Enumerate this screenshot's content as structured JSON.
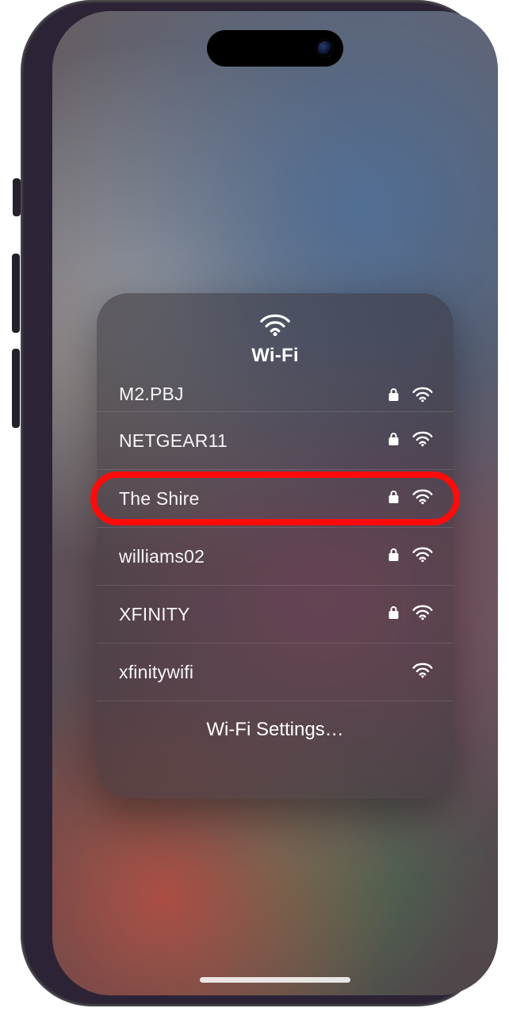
{
  "panel": {
    "title": "Wi-Fi",
    "settings_label": "Wi-Fi Settings…",
    "networks": [
      {
        "ssid": "M2.PBJ",
        "locked": true,
        "highlighted": false,
        "cut": true
      },
      {
        "ssid": "NETGEAR11",
        "locked": true,
        "highlighted": false,
        "cut": false
      },
      {
        "ssid": "The Shire",
        "locked": true,
        "highlighted": true,
        "cut": false
      },
      {
        "ssid": "williams02",
        "locked": true,
        "highlighted": false,
        "cut": false
      },
      {
        "ssid": "XFINITY",
        "locked": true,
        "highlighted": false,
        "cut": false
      },
      {
        "ssid": "xfinitywifi",
        "locked": false,
        "highlighted": false,
        "cut": false
      }
    ]
  }
}
